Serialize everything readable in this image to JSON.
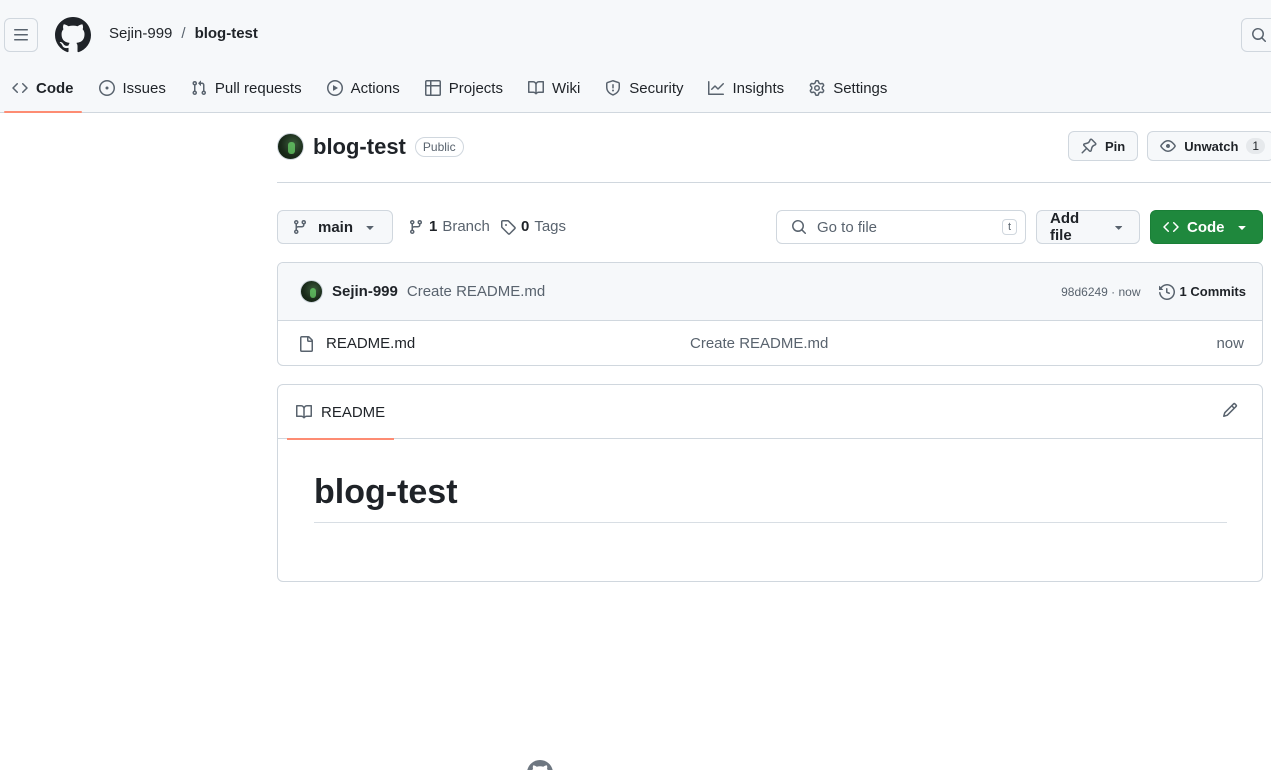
{
  "header": {
    "menu_icon": "hamburger-icon",
    "logo_icon": "github-mark-icon",
    "owner": "Sejin-999",
    "separator": "/",
    "repo": "blog-test",
    "search_icon": "search-icon"
  },
  "nav": {
    "tabs": [
      {
        "label": "Code",
        "icon": "code-icon",
        "active": true
      },
      {
        "label": "Issues",
        "icon": "issue-icon"
      },
      {
        "label": "Pull requests",
        "icon": "pull-request-icon"
      },
      {
        "label": "Actions",
        "icon": "play-icon"
      },
      {
        "label": "Projects",
        "icon": "table-icon"
      },
      {
        "label": "Wiki",
        "icon": "book-icon"
      },
      {
        "label": "Security",
        "icon": "shield-icon"
      },
      {
        "label": "Insights",
        "icon": "graph-icon"
      },
      {
        "label": "Settings",
        "icon": "gear-icon"
      }
    ]
  },
  "repo": {
    "name": "blog-test",
    "visibility": "Public",
    "pin_label": "Pin",
    "unwatch_label": "Unwatch",
    "watch_count": "1"
  },
  "toolbar": {
    "branch": "main",
    "branch_count": "1",
    "branch_label": "Branch",
    "tag_count": "0",
    "tag_label": "Tags",
    "goto_placeholder": "Go to file",
    "goto_shortcut": "t",
    "add_file_label": "Add file",
    "code_label": "Code",
    "accent_color": "#1f883d"
  },
  "commit": {
    "author": "Sejin-999",
    "message": "Create README.md",
    "hash_time": "98d6249 · now",
    "commit_count": "1 Commits"
  },
  "files": [
    {
      "name": "README.md",
      "commit": "Create README.md",
      "age": "now"
    }
  ],
  "readme": {
    "tab_label": "README",
    "heading": "blog-test"
  }
}
